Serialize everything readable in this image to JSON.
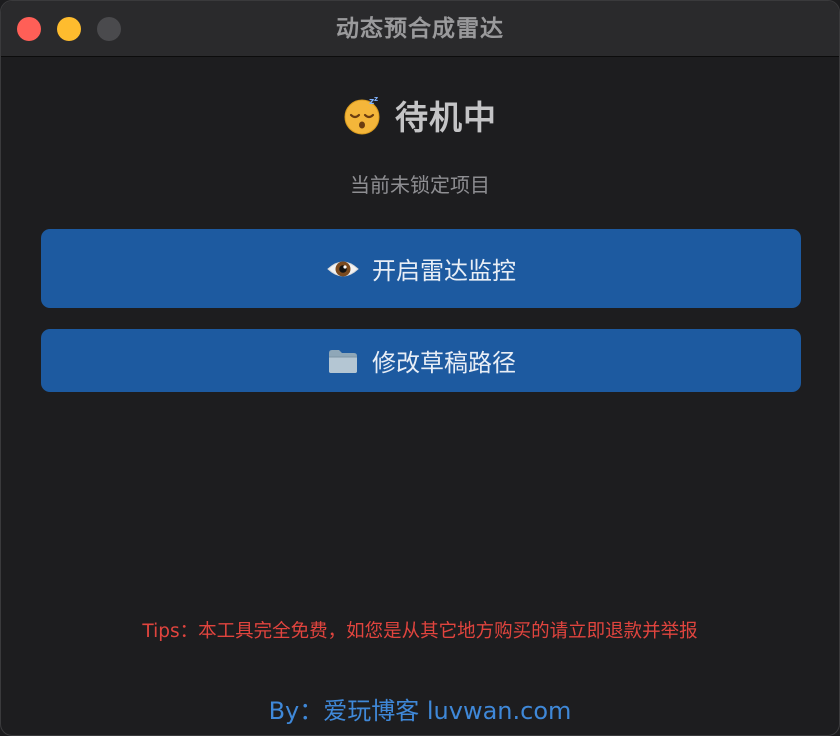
{
  "window": {
    "title": "动态预合成雷达"
  },
  "status": {
    "icon": "sleeping-face-icon",
    "text": "待机中",
    "project": "当前未锁定项目"
  },
  "buttons": {
    "radar": {
      "icon": "eye-icon",
      "label": "开启雷达监控"
    },
    "path": {
      "icon": "folder-icon",
      "label": "修改草稿路径"
    }
  },
  "footer": {
    "tips": "Tips：本工具完全免费，如您是从其它地方购买的请立即退款并举报",
    "byline": "By：爱玩博客 luvwan.com"
  },
  "colors": {
    "button_bg": "#1d5aa0",
    "tips": "#e0443e",
    "byline": "#3f88d8",
    "close": "#ff5f57",
    "minimize": "#febc2e",
    "maximize_disabled": "#4a4a4d"
  }
}
